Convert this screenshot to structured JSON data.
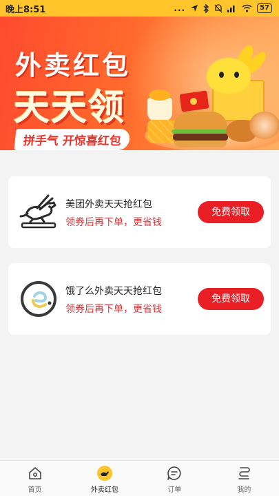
{
  "status_bar": {
    "time": "晚上8:51",
    "indicators": "...",
    "battery": "57"
  },
  "banner": {
    "line1": "外卖红包",
    "line2": "天天领",
    "slogan": "拼手气 开惊喜红包"
  },
  "cards": [
    {
      "title": "美团外卖天天抢红包",
      "subtitle": "领券后再下单，更省钱",
      "button": "免费领取",
      "logo_icon": "meituan-kangaroo-icon"
    },
    {
      "title": "饿了么外卖天天抢红包",
      "subtitle": "领券后再下单，更省钱",
      "button": "免费领取",
      "logo_icon": "eleme-icon"
    }
  ],
  "nav": [
    {
      "label": "首页",
      "icon": "home-icon"
    },
    {
      "label": "外卖红包",
      "icon": "takeout-redpacket-icon",
      "active": true
    },
    {
      "label": "订单",
      "icon": "order-icon"
    },
    {
      "label": "我的",
      "icon": "profile-icon"
    }
  ],
  "colors": {
    "status_bar_bg": "#ffc52b",
    "accent_red": "#ea1f26",
    "subtitle_red": "#d5383b",
    "nav_active_yellow": "#ffc52b"
  }
}
